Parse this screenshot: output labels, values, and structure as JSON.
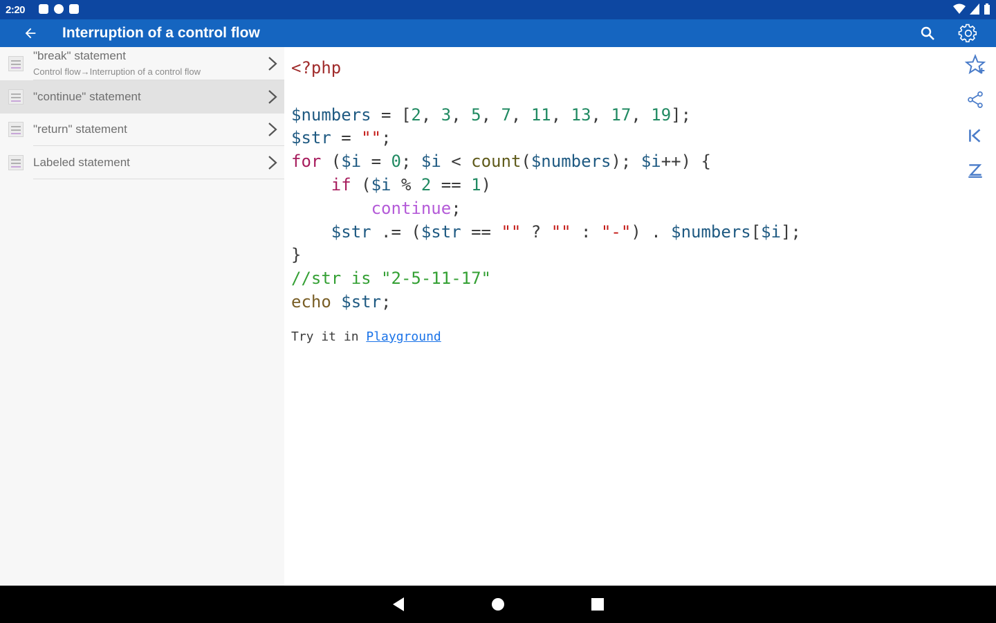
{
  "status_bar": {
    "time": "2:20",
    "icons": [
      "notification-icon",
      "p-icon",
      "sd-card-icon"
    ],
    "right_icons": [
      "wifi-icon",
      "signal-icon",
      "battery-icon"
    ]
  },
  "app_bar": {
    "title": "Interruption of a control flow",
    "color": "#1565c0",
    "status_color": "#0d47a1"
  },
  "sidebar": {
    "items": [
      {
        "label": "\"break\" statement",
        "sub": "Control flow→Interruption of a control flow",
        "active": false
      },
      {
        "label": "\"continue\" statement",
        "active": true
      },
      {
        "label": "\"return\" statement",
        "active": false
      },
      {
        "label": "Labeled statement",
        "active": false
      }
    ]
  },
  "code": {
    "lines": [
      "<?php",
      "",
      "$numbers = [2, 3, 5, 7, 11, 13, 17, 19];",
      "$str = \"\";",
      "for ($i = 0; $i < count($numbers); $i++) {",
      "    if ($i % 2 == 1)",
      "        continue;",
      "    $str .= ($str == \"\" ? \"\" : \"-\") . $numbers[$i];",
      "}",
      "//str is \"2-5-11-17\"",
      "echo $str;"
    ]
  },
  "try_it": {
    "prefix": "Try it in ",
    "link": "Playground"
  },
  "right_rail": {
    "icons": [
      "star-add-icon",
      "share-icon",
      "first-page-icon",
      "last-page-icon"
    ]
  },
  "nav_bar": {
    "icons": [
      "back-nav-icon",
      "home-nav-icon",
      "recents-nav-icon"
    ]
  }
}
